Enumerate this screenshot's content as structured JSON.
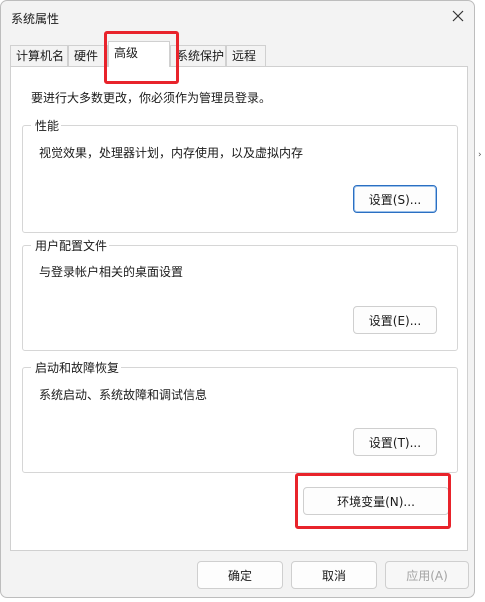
{
  "window": {
    "title": "系统属性"
  },
  "tabs": [
    {
      "label": "计算机名"
    },
    {
      "label": "硬件"
    },
    {
      "label": "高级"
    },
    {
      "label": "系统保护"
    },
    {
      "label": "远程"
    }
  ],
  "active_tab": "高级",
  "panel": {
    "admin_note": "要进行大多数更改，你必须作为管理员登录。",
    "performance": {
      "title": "性能",
      "description": "视觉效果，处理器计划，内存使用，以及虚拟内存",
      "button": "设置(S)..."
    },
    "user_profiles": {
      "title": "用户配置文件",
      "description": "与登录帐户相关的桌面设置",
      "button": "设置(E)..."
    },
    "startup_recovery": {
      "title": "启动和故障恢复",
      "description": "系统启动、系统故障和调试信息",
      "button": "设置(T)..."
    },
    "env_button": "环境变量(N)..."
  },
  "footer": {
    "ok": "确定",
    "cancel": "取消",
    "apply": "应用(A)"
  },
  "colors": {
    "highlight": "#e8232b",
    "focus": "#2b6fc2"
  }
}
